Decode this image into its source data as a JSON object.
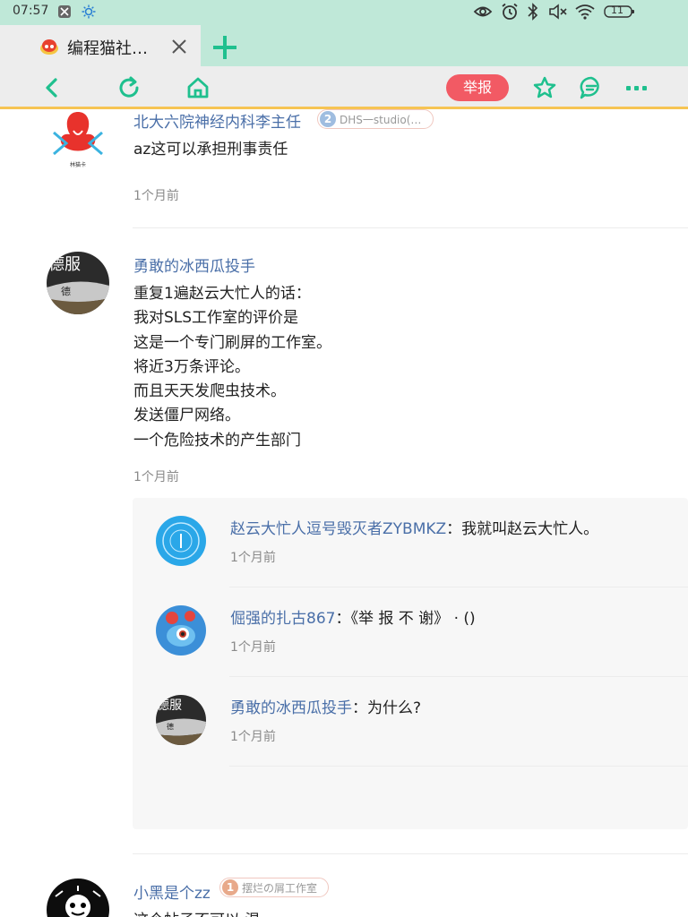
{
  "status_bar": {
    "time": "07:57",
    "battery": "11",
    "icons": [
      "scissors-icon",
      "sun-icon",
      "eye-icon",
      "alarm-icon",
      "bluetooth-icon",
      "mute-icon",
      "wifi-icon",
      "battery-icon"
    ]
  },
  "tab": {
    "title": "编程猫社…"
  },
  "toolbar": {
    "report_label": "举报",
    "icons": [
      "back-icon",
      "refresh-icon",
      "home-icon",
      "star-icon",
      "comment-icon",
      "more-icon"
    ]
  },
  "comments": [
    {
      "username": "北大六院神经内科李主任",
      "badge_level": "2",
      "badge_text": "DHS一studio(…",
      "lines": [
        "az这可以承担刑事责任"
      ],
      "time": "1个月前"
    },
    {
      "username": "勇敢的冰西瓜投手",
      "lines": [
        "重复1遍赵云大忙人的话：",
        "我对SLS工作室的评价是",
        "这是一个专门刷屏的工作室。",
        "将近3万条评论。",
        "而且天天发爬虫技术。",
        "发送僵尸网络。",
        "一个危险技术的产生部门"
      ],
      "time": "1个月前",
      "avatar_text": "德服",
      "replies": [
        {
          "username": "赵云大忙人逗号毁灭者ZYBMKZ",
          "text": "：我就叫赵云大忙人。",
          "time": "1个月前"
        },
        {
          "username": "倔强的扎古867",
          "text": "：《举 报 不 谢》 · ()",
          "time": "1个月前"
        },
        {
          "username": "勇敢的冰西瓜投手",
          "text": "：为什么?",
          "time": "1个月前",
          "avatar_text": "德服"
        }
      ]
    },
    {
      "username": "小黑是个zz",
      "badge_level": "1",
      "badge_text": "摆烂の屑工作室",
      "lines": [
        "这个帖子不可以 温"
      ]
    }
  ],
  "colors": {
    "accent_green": "#1fc08e",
    "username_blue": "#4a6fa8",
    "report_red": "#f25a64",
    "status_bg": "#bfe8d8"
  }
}
